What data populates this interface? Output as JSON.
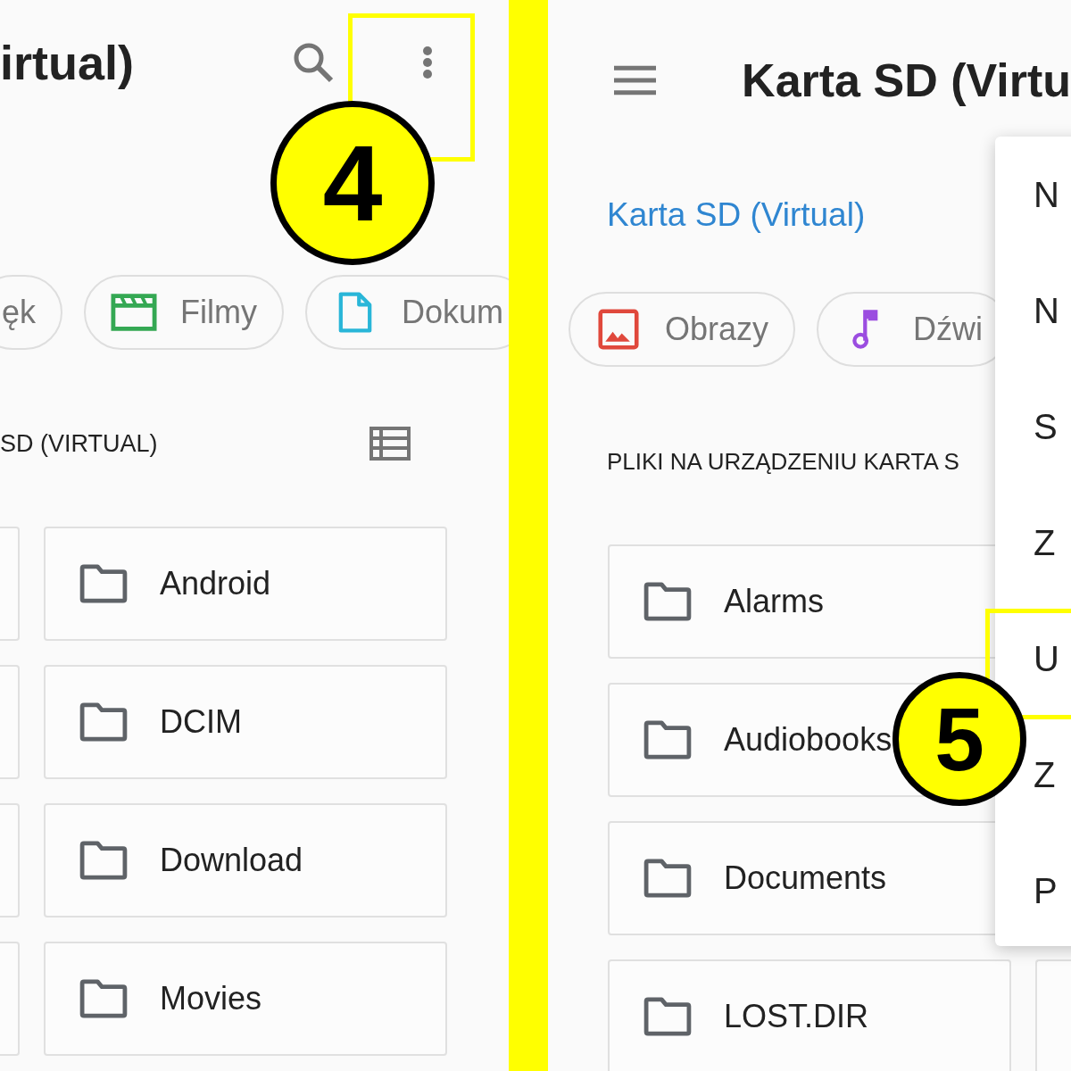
{
  "left_screen": {
    "title": "irtual)",
    "chips": [
      {
        "kind": "none",
        "label": "ęk"
      },
      {
        "kind": "video",
        "label": "Filmy"
      },
      {
        "kind": "document",
        "label": "Dokum"
      }
    ],
    "section_header": "SD (VIRTUAL)",
    "folders": [
      {
        "name": "Android"
      },
      {
        "name": "DCIM"
      },
      {
        "name": "Download"
      },
      {
        "name": "Movies"
      }
    ],
    "step_badge": "4"
  },
  "right_screen": {
    "title": "Karta SD (Virtu",
    "breadcrumb": "Karta SD (Virtual)",
    "chips": [
      {
        "kind": "image",
        "label": "Obrazy"
      },
      {
        "kind": "audio",
        "label": "Dźwi"
      }
    ],
    "section_header": "PLIKI NA URZĄDZENIU KARTA S",
    "folders": [
      {
        "name": "Alarms"
      },
      {
        "name": "Audiobooks"
      },
      {
        "name": "Documents"
      },
      {
        "name": "LOST.DIR"
      }
    ],
    "menu": [
      {
        "label": "N"
      },
      {
        "label": "N"
      },
      {
        "label": "S"
      },
      {
        "label": "Z"
      },
      {
        "label": "U"
      },
      {
        "label": "Z"
      },
      {
        "label": "P"
      }
    ],
    "step_badge": "5"
  }
}
